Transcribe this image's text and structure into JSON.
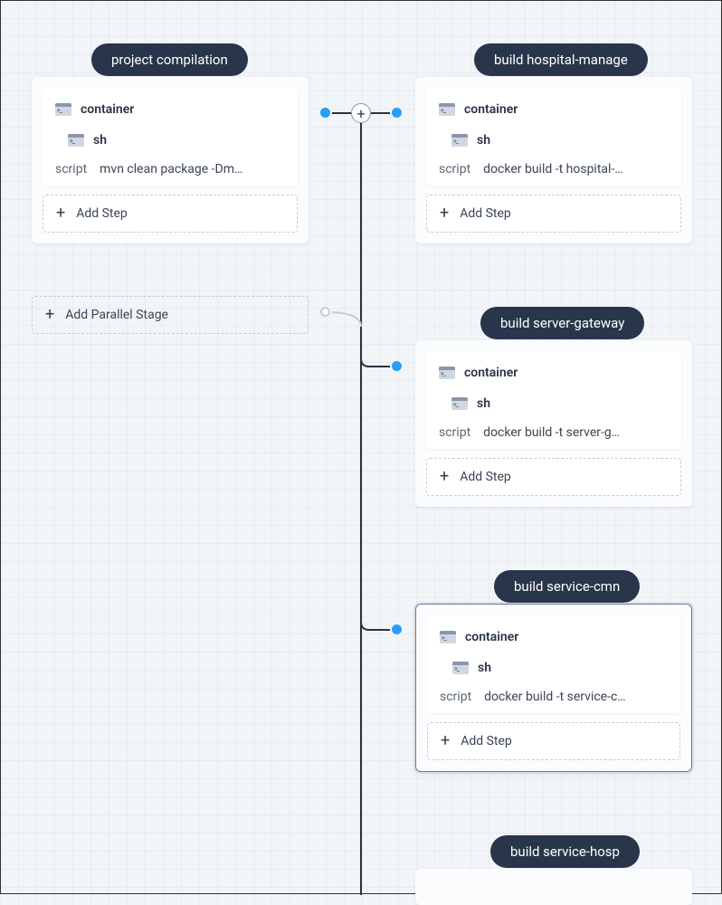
{
  "labels": {
    "container": "container",
    "sh": "sh",
    "script": "script",
    "addStep": "Add Step",
    "addParallel": "Add Parallel Stage"
  },
  "stages": {
    "left": {
      "title": "project compilation",
      "script": "mvn clean package -Dm…"
    },
    "r1": {
      "title": "build hospital-manage",
      "script": "docker build -t hospital-…"
    },
    "r2": {
      "title": "build server-gateway",
      "script": "docker build -t server-g…"
    },
    "r3": {
      "title": "build service-cmn",
      "script": "docker build -t service-c…"
    },
    "r4": {
      "title": "build service-hosp"
    }
  }
}
